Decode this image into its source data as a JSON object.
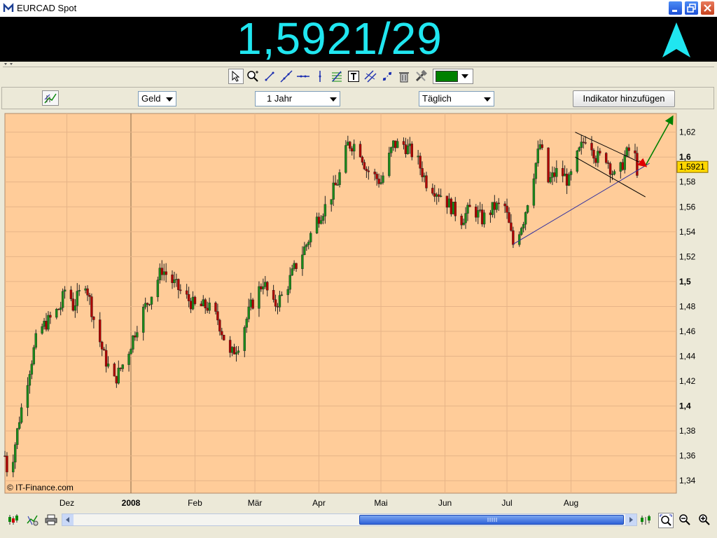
{
  "window": {
    "title": "EURCAD Spot"
  },
  "quote": {
    "price": "1,5921/29",
    "direction": "up",
    "price_color": "#20E6F0"
  },
  "toolbar": {
    "tools": [
      "pointer-icon",
      "zoom-icon",
      "line-icon",
      "extended-line-icon",
      "horizontal-line-icon",
      "vertical-line-icon",
      "fibonacci-icon",
      "text-icon",
      "parallel-lines-icon",
      "points-icon",
      "trash-icon",
      "tools-icon"
    ],
    "color": "#008000"
  },
  "controls": {
    "price_type": "Geld",
    "period": "1 Jahr",
    "interval": "Täglich",
    "add_indicator": "Indikator hinzufügen"
  },
  "chart_data": {
    "type": "candlestick",
    "background": "#FFCC99",
    "watermark": "© IT-Finance.com",
    "x_labels": [
      "Dez",
      "2008",
      "Feb",
      "Mär",
      "Apr",
      "Mai",
      "Jun",
      "Jul",
      "Aug"
    ],
    "y_ticks": [
      "1,34",
      "1,36",
      "1,38",
      "1,4",
      "1,42",
      "1,44",
      "1,46",
      "1,48",
      "1,5",
      "1,52",
      "1,54",
      "1,56",
      "1,58",
      "1,6",
      "1,62"
    ],
    "ylim": [
      1.33,
      1.635
    ],
    "last_value_label": "1,5921",
    "last_value": 1.5921,
    "close_path": [
      [
        "2007-11-01",
        1.36
      ],
      [
        "2007-11-03",
        1.34
      ],
      [
        "2007-11-08",
        1.39
      ],
      [
        "2007-11-13",
        1.43
      ],
      [
        "2007-11-17",
        1.46
      ],
      [
        "2007-11-23",
        1.47
      ],
      [
        "2007-11-28",
        1.48
      ],
      [
        "2007-12-01",
        1.5
      ],
      [
        "2007-12-04",
        1.48
      ],
      [
        "2007-12-10",
        1.5
      ],
      [
        "2007-12-14",
        1.47
      ],
      [
        "2007-12-19",
        1.44
      ],
      [
        "2007-12-24",
        1.42
      ],
      [
        "2007-12-30",
        1.44
      ],
      [
        "2008-01-05",
        1.47
      ],
      [
        "2008-01-11",
        1.49
      ],
      [
        "2008-01-16",
        1.51
      ],
      [
        "2008-01-21",
        1.5
      ],
      [
        "2008-01-26",
        1.49
      ],
      [
        "2008-02-01",
        1.48
      ],
      [
        "2008-02-07",
        1.48
      ],
      [
        "2008-02-12",
        1.47
      ],
      [
        "2008-02-18",
        1.44
      ],
      [
        "2008-02-22",
        1.45
      ],
      [
        "2008-02-28",
        1.48
      ],
      [
        "2008-03-05",
        1.5
      ],
      [
        "2008-03-10",
        1.48
      ],
      [
        "2008-03-15",
        1.49
      ],
      [
        "2008-03-20",
        1.51
      ],
      [
        "2008-03-26",
        1.53
      ],
      [
        "2008-03-31",
        1.55
      ],
      [
        "2008-04-04",
        1.56
      ],
      [
        "2008-04-10",
        1.58
      ],
      [
        "2008-04-15",
        1.61
      ],
      [
        "2008-04-20",
        1.61
      ],
      [
        "2008-04-24",
        1.59
      ],
      [
        "2008-05-01",
        1.58
      ],
      [
        "2008-05-07",
        1.61
      ],
      [
        "2008-05-12",
        1.61
      ],
      [
        "2008-05-18",
        1.6
      ],
      [
        "2008-05-23",
        1.58
      ],
      [
        "2008-05-30",
        1.57
      ],
      [
        "2008-06-04",
        1.56
      ],
      [
        "2008-06-09",
        1.55
      ],
      [
        "2008-06-14",
        1.56
      ],
      [
        "2008-06-19",
        1.55
      ],
      [
        "2008-06-25",
        1.56
      ],
      [
        "2008-06-30",
        1.56
      ],
      [
        "2008-07-04",
        1.53
      ],
      [
        "2008-07-09",
        1.55
      ],
      [
        "2008-07-13",
        1.58
      ],
      [
        "2008-07-17",
        1.61
      ],
      [
        "2008-07-21",
        1.58
      ],
      [
        "2008-07-26",
        1.59
      ],
      [
        "2008-07-31",
        1.58
      ],
      [
        "2008-08-04",
        1.6
      ],
      [
        "2008-08-09",
        1.62
      ],
      [
        "2008-08-13",
        1.6
      ],
      [
        "2008-08-18",
        1.6
      ],
      [
        "2008-08-23",
        1.58
      ],
      [
        "2008-08-27",
        1.6
      ],
      [
        "2008-08-31",
        1.61
      ],
      [
        "2008-09-02",
        1.59
      ]
    ],
    "drawings": [
      {
        "type": "trendline",
        "color": "#3030A0",
        "from": [
          "2008-07-04",
          1.53
        ],
        "to": [
          "2008-09-08",
          1.595
        ]
      },
      {
        "type": "channel-upper",
        "color": "#000000",
        "from": [
          "2008-08-03",
          1.62
        ],
        "to": [
          "2008-09-03",
          1.596
        ]
      },
      {
        "type": "channel-lower",
        "color": "#000000",
        "from": [
          "2008-08-03",
          1.6
        ],
        "to": [
          "2008-09-06",
          1.568
        ]
      },
      {
        "type": "arrow",
        "color": "#008000",
        "from": [
          "2008-09-06",
          1.593
        ],
        "to": [
          "2008-09-19",
          1.632
        ]
      },
      {
        "type": "arrow",
        "color": "#E00000",
        "from": [
          "2008-09-03",
          1.597
        ],
        "to": [
          "2008-09-06",
          1.593
        ]
      }
    ]
  }
}
